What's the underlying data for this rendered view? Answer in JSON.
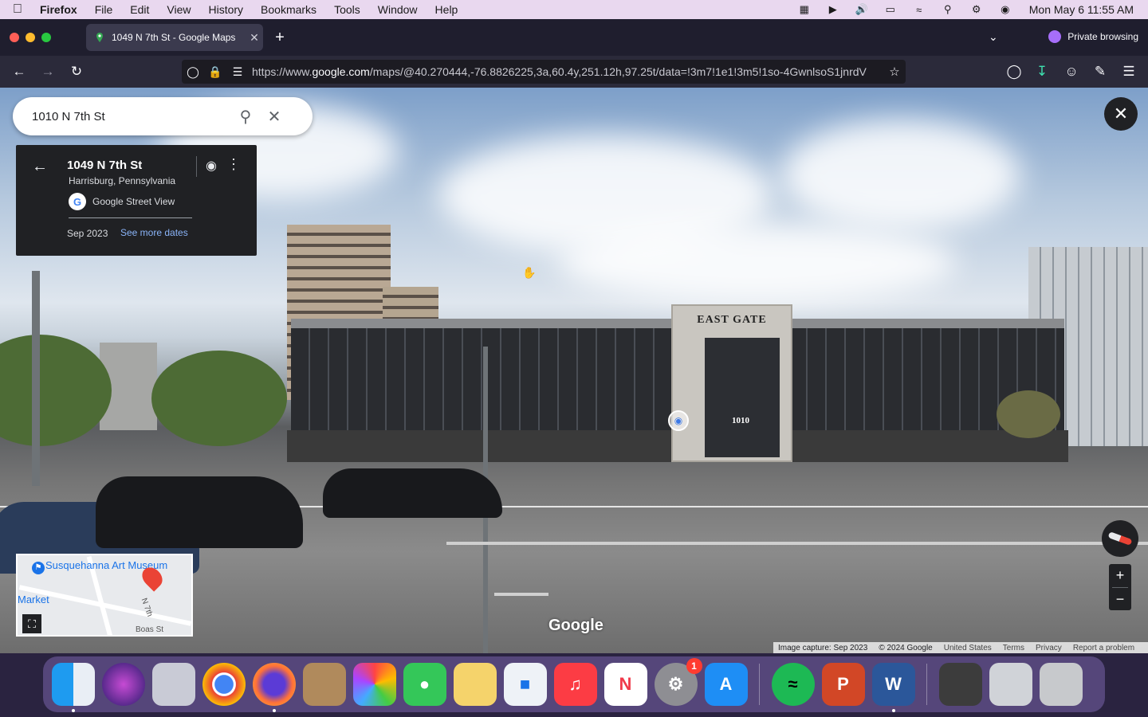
{
  "menubar": {
    "app_name": "Firefox",
    "items": [
      "File",
      "Edit",
      "View",
      "History",
      "Bookmarks",
      "Tools",
      "Window",
      "Help"
    ],
    "clock": "Mon May 6  11:55 AM"
  },
  "browser": {
    "tab_title": "1049 N 7th St - Google Maps",
    "private_label": "Private browsing",
    "url_prefix": "https://www.",
    "url_domain": "google.com",
    "url_path": "/maps/@40.270444,-76.8826225,3a,60.4y,251.12h,97.25t/data=!3m7!1e1!3m5!1so-4GwnlsoS1jnrdV"
  },
  "maps": {
    "search_value": "1010 N 7th St",
    "card": {
      "address": "1049 N 7th St",
      "city": "Harrisburg, Pennsylvania",
      "source": "Google Street View",
      "date": "Sep 2023",
      "more_dates": "See more dates"
    },
    "building_sign": "EAST GATE",
    "building_number": "1010",
    "watermark": "Google",
    "minimap": {
      "museum": "Susquehanna Art Museum",
      "market": "Market",
      "street": "N 7th",
      "boas": "Boas St"
    },
    "footer": {
      "capture": "Image capture: Sep 2023",
      "copyright": "© 2024 Google",
      "country": "United States",
      "terms": "Terms",
      "privacy": "Privacy",
      "report": "Report a problem"
    }
  },
  "dock": {
    "items": [
      "Finder",
      "Siri",
      "Launchpad",
      "Chrome",
      "Firefox",
      "Contacts",
      "Photos",
      "Messages",
      "Pages",
      "Numbers",
      "Music",
      "News",
      "System Settings",
      "App Store",
      "Spotify",
      "PowerPoint",
      "Word",
      "Preview",
      "Screenshot",
      "Trash"
    ],
    "settings_badge": "1"
  }
}
